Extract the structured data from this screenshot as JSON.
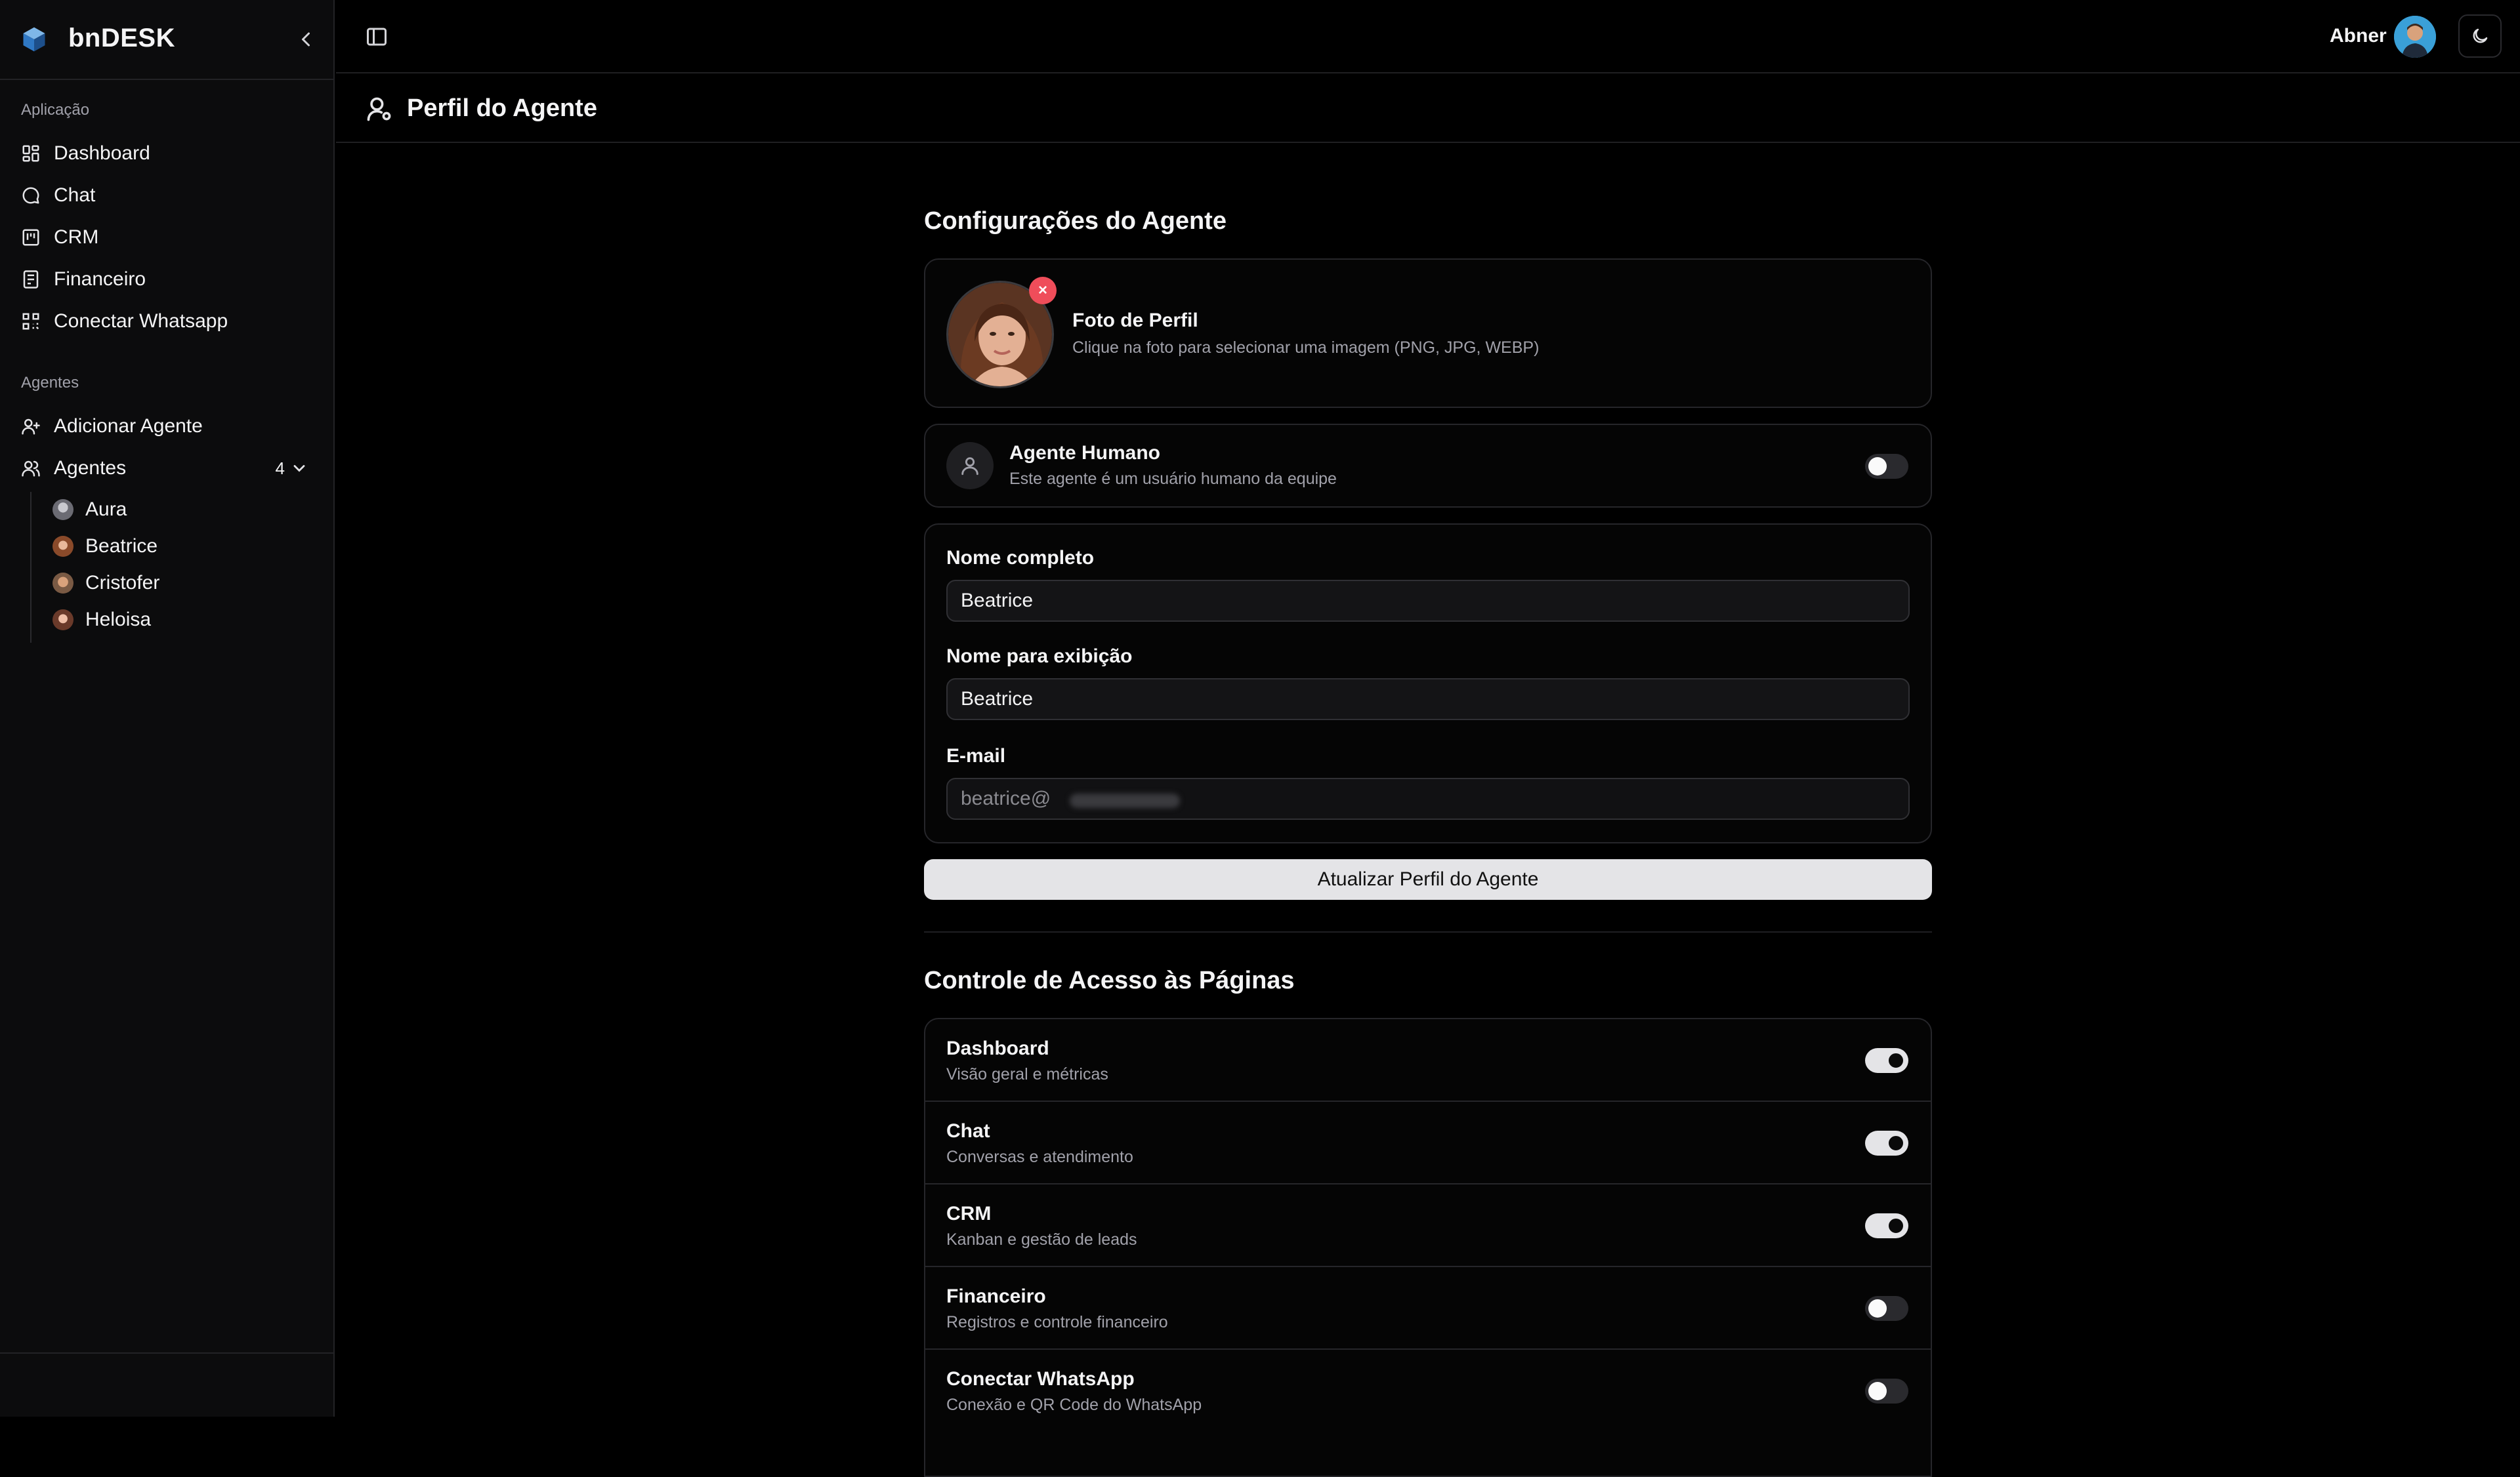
{
  "app": {
    "name": "bnDESK"
  },
  "sidebar": {
    "section_app": "Aplicação",
    "app_items": [
      {
        "label": "Dashboard",
        "icon": "dashboard-icon"
      },
      {
        "label": "Chat",
        "icon": "chat-icon"
      },
      {
        "label": "CRM",
        "icon": "kanban-icon"
      },
      {
        "label": "Financeiro",
        "icon": "finance-icon"
      },
      {
        "label": "Conectar Whatsapp",
        "icon": "qr-icon"
      }
    ],
    "section_agents": "Agentes",
    "add_agent": "Adicionar Agente",
    "agents_label": "Agentes",
    "agents_count": "4",
    "agents": [
      {
        "name": "Aura"
      },
      {
        "name": "Beatrice"
      },
      {
        "name": "Cristofer"
      },
      {
        "name": "Heloisa"
      }
    ]
  },
  "topbar": {
    "user_name": "Abner"
  },
  "page": {
    "title": "Perfil do Agente"
  },
  "agent_config": {
    "heading": "Configurações do Agente",
    "photo_title": "Foto de Perfil",
    "photo_desc": "Clique na foto para selecionar uma imagem (PNG, JPG, WEBP)",
    "human_title": "Agente Humano",
    "human_desc": "Este agente é um usuário humano da equipe",
    "human_enabled": false,
    "full_name_label": "Nome completo",
    "full_name_value": "Beatrice",
    "display_name_label": "Nome para exibição",
    "display_name_value": "Beatrice",
    "email_label": "E-mail",
    "email_value": "beatrice@",
    "submit_label": "Atualizar Perfil do Agente"
  },
  "access_control": {
    "heading": "Controle de Acesso às Páginas",
    "pages": [
      {
        "title": "Dashboard",
        "desc": "Visão geral e métricas",
        "enabled": true
      },
      {
        "title": "Chat",
        "desc": "Conversas e atendimento",
        "enabled": true
      },
      {
        "title": "CRM",
        "desc": "Kanban e gestão de leads",
        "enabled": true
      },
      {
        "title": "Financeiro",
        "desc": "Registros e controle financeiro",
        "enabled": false
      },
      {
        "title": "Conectar WhatsApp",
        "desc": "Conexão e QR Code do WhatsApp",
        "enabled": false
      }
    ]
  },
  "colors": {
    "accent": "#e4e4e7",
    "danger": "#ef4d5a",
    "background": "#000000"
  }
}
